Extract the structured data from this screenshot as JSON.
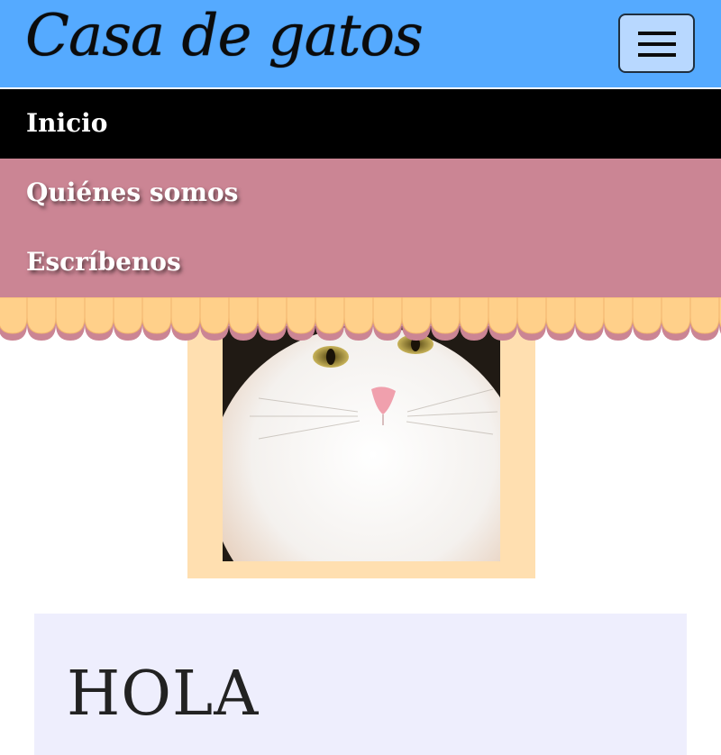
{
  "header": {
    "site_title": "Casa de gatos",
    "background_color": "#55aaff",
    "menu_icon": "hamburger-icon"
  },
  "nav": {
    "items": [
      {
        "label": "Inicio",
        "active": true
      },
      {
        "label": "Quiénes somos",
        "active": false
      },
      {
        "label": "Escríbenos",
        "active": false
      }
    ],
    "active_color": "#000000",
    "item_color": "#cb8594"
  },
  "awning": {
    "scallop_color": "#ffd08a",
    "shadow_color": "#cb8594"
  },
  "hero": {
    "image": "white-kitten-photo",
    "frame_color": "#ffdfb0"
  },
  "content": {
    "heading": "HOLA",
    "background_color": "#eeeefd"
  }
}
